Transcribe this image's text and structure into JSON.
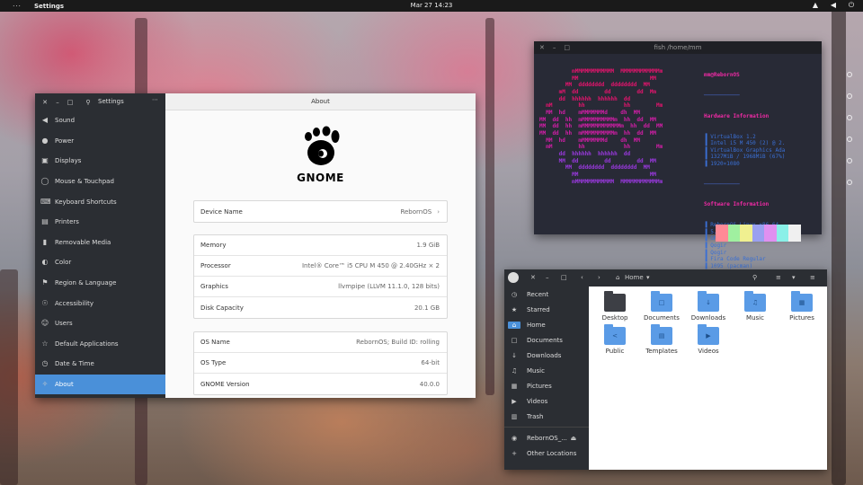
{
  "topbar": {
    "activities": "···",
    "app": "Settings",
    "clock": "Mar 27  14:23"
  },
  "settings": {
    "title": "Settings",
    "main_title": "About",
    "logo_text": "GNOME",
    "sidebar": [
      {
        "label": "Sound",
        "icon": "speaker-icon",
        "glyph": "◀"
      },
      {
        "label": "Power",
        "icon": "power-icon",
        "glyph": "●"
      },
      {
        "label": "Displays",
        "icon": "display-icon",
        "glyph": "▣"
      },
      {
        "label": "Mouse & Touchpad",
        "icon": "mouse-icon",
        "glyph": "◯"
      },
      {
        "label": "Keyboard Shortcuts",
        "icon": "keyboard-icon",
        "glyph": "⌨"
      },
      {
        "label": "Printers",
        "icon": "printer-icon",
        "glyph": "▤"
      },
      {
        "label": "Removable Media",
        "icon": "media-icon",
        "glyph": "▮"
      },
      {
        "label": "Color",
        "icon": "color-icon",
        "glyph": "◐"
      },
      {
        "label": "Region & Language",
        "icon": "flag-icon",
        "glyph": "⚑"
      },
      {
        "label": "Accessibility",
        "icon": "accessibility-icon",
        "glyph": "☉"
      },
      {
        "label": "Users",
        "icon": "users-icon",
        "glyph": "☺"
      },
      {
        "label": "Default Applications",
        "icon": "star-icon",
        "glyph": "☆"
      },
      {
        "label": "Date & Time",
        "icon": "clock-icon",
        "glyph": "◷"
      },
      {
        "label": "About",
        "icon": "sparkle-icon",
        "glyph": "✧"
      }
    ],
    "device": {
      "label": "Device Name",
      "value": "RebornOS"
    },
    "hardware": [
      {
        "label": "Memory",
        "value": "1.9 GiB"
      },
      {
        "label": "Processor",
        "value": "Intel® Core™ i5 CPU M 450 @ 2.40GHz × 2"
      },
      {
        "label": "Graphics",
        "value": "llvmpipe (LLVM 11.1.0, 128 bits)"
      },
      {
        "label": "Disk Capacity",
        "value": "20.1 GB"
      }
    ],
    "os": [
      {
        "label": "OS Name",
        "value": "RebornOS; Build ID: rolling"
      },
      {
        "label": "OS Type",
        "value": "64-bit"
      },
      {
        "label": "GNOME Version",
        "value": "40.0.0"
      }
    ]
  },
  "terminal": {
    "title": "fish /home/mm",
    "ascii": [
      "          mMMMMMMMMMMMM  MMMMMMMMMMMMm",
      "          MM                      MM",
      "        MM  dddddddd  dddddddd  MM",
      "      mM  dd        dd        dd  Mm",
      "      dd  hhhhhh  hhhhhh  dd",
      "  mM        hh            hh        Mm",
      "  MM  hd    mMMMMMMMd    dh  MM",
      "MM  dd  hh  mMMMMMMMMMMm  hh  dd  MM",
      "MM  dd  hh  mMMMMMMMMMMMMm  hh  dd  MM",
      "MM  dd  hh  mMMMMMMMMMMm  hh  dd  MM",
      "  MM  hd    mMMMMMMMd    dh  MM",
      "  mM        hh            hh        Mm",
      "      dd  hhhhhh  hhhhhh  dd",
      "      MM  dd        dd        dd  MM",
      "        MM  dddddddd  dddddddd  MM",
      "          MM                      MM",
      "          mMMMMMMMMMMMM  MMMMMMMMMMMMm"
    ],
    "user_host": "mm@RebornOS",
    "divider": "───────────",
    "hw_heading": "Hardware Information",
    "hw": [
      "▐ VirtualBox 1.2",
      "▐ Intel i5 M 450 (2) @ 2.",
      "▐ VirtualBox Graphics Ada",
      "▐ 1327MiB / 1968MiB (67%)",
      "▐ 1920×1080"
    ],
    "sw_heading": "Software Information",
    "sw": [
      "▐ RebornOS Linux x86_64",
      "▐ 5.11.10-arch1-1",
      "▐ GNOME 3.38.4",
      "▐ Qogir",
      "▐ Qogir",
      "▐ Fira Code Regular",
      "▐ 1095 (pacman)"
    ],
    "palette": [
      "#ff8a96",
      "#a0f0a0",
      "#f0f090",
      "#9aa0f0",
      "#e090f0",
      "#8af0e8",
      "#f0f0f0"
    ]
  },
  "files": {
    "path": "Home",
    "sidebar": [
      {
        "label": "Recent",
        "icon": "clock-icon",
        "glyph": "◷"
      },
      {
        "label": "Starred",
        "icon": "star-icon",
        "glyph": "★"
      },
      {
        "label": "Home",
        "icon": "home-icon",
        "glyph": "⌂"
      },
      {
        "label": "Documents",
        "icon": "document-icon",
        "glyph": "□"
      },
      {
        "label": "Downloads",
        "icon": "download-icon",
        "glyph": "↓"
      },
      {
        "label": "Music",
        "icon": "music-icon",
        "glyph": "♫"
      },
      {
        "label": "Pictures",
        "icon": "picture-icon",
        "glyph": "▦"
      },
      {
        "label": "Videos",
        "icon": "video-icon",
        "glyph": "▶"
      },
      {
        "label": "Trash",
        "icon": "trash-icon",
        "glyph": "▥"
      },
      {
        "label": "RebornOS_...",
        "icon": "disc-icon",
        "glyph": "◉"
      },
      {
        "label": "Other Locations",
        "icon": "plus-icon",
        "glyph": "+"
      }
    ],
    "folders": [
      {
        "label": "Desktop",
        "icon": "desktop-folder-icon",
        "glyph": ""
      },
      {
        "label": "Documents",
        "icon": "documents-folder-icon",
        "glyph": "□"
      },
      {
        "label": "Downloads",
        "icon": "downloads-folder-icon",
        "glyph": "↓"
      },
      {
        "label": "Music",
        "icon": "music-folder-icon",
        "glyph": "♫"
      },
      {
        "label": "Pictures",
        "icon": "pictures-folder-icon",
        "glyph": "▦"
      },
      {
        "label": "Public",
        "icon": "public-folder-icon",
        "glyph": "<"
      },
      {
        "label": "Templates",
        "icon": "templates-folder-icon",
        "glyph": "▤"
      },
      {
        "label": "Videos",
        "icon": "videos-folder-icon",
        "glyph": "▶"
      }
    ]
  }
}
